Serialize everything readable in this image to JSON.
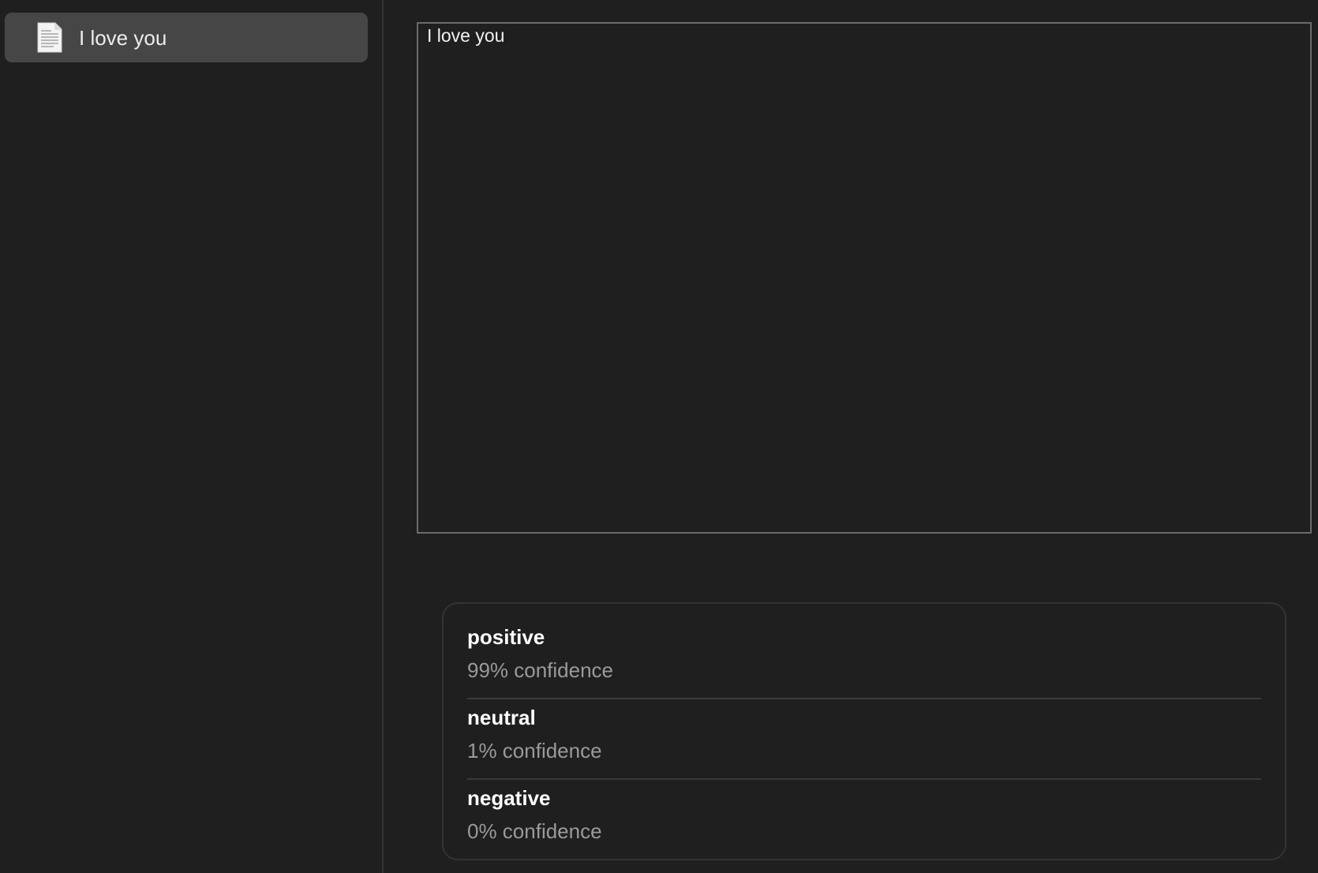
{
  "sidebar": {
    "items": [
      {
        "label": "I love you",
        "icon": "document-icon",
        "selected": true
      }
    ]
  },
  "editor": {
    "text": "I love you"
  },
  "results": {
    "items": [
      {
        "label": "positive",
        "confidence_text": "99% confidence",
        "confidence": 0.99
      },
      {
        "label": "neutral",
        "confidence_text": "1% confidence",
        "confidence": 0.01
      },
      {
        "label": "negative",
        "confidence_text": "0% confidence",
        "confidence": 0.0
      }
    ]
  },
  "colors": {
    "background": "#1f1f1f",
    "selected_item": "#464646",
    "border": "#6b6b6b",
    "muted_text": "#9a9a9a"
  }
}
